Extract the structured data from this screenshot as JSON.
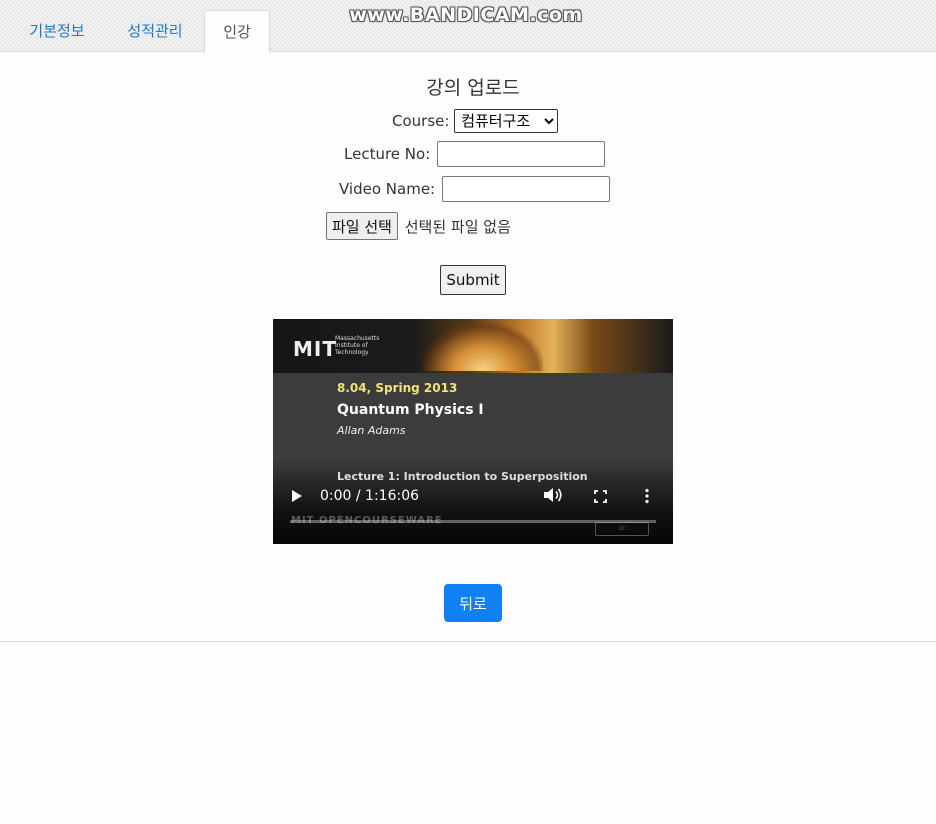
{
  "tabs": [
    {
      "label": "기본정보",
      "active": false
    },
    {
      "label": "성적관리",
      "active": false
    },
    {
      "label": "인강",
      "active": true
    }
  ],
  "watermark": "www.BANDICAM.com",
  "page_title": "강의 업로드",
  "form": {
    "course_label": "Course:",
    "course_selected": "컴퓨터구조",
    "lecture_no_label": "Lecture No:",
    "lecture_no_value": "",
    "video_name_label": "Video Name:",
    "video_name_value": "",
    "file_button_label": "파일 선택",
    "file_status": "선택된 파일 없음",
    "submit_label": "Submit"
  },
  "video": {
    "logo_text": "MIT",
    "institution": "Massachusetts Institute of Technology",
    "course_code": "8.04, Spring 2013",
    "course_title": "Quantum Physics I",
    "instructor": "Allan Adams",
    "lecture_title": "Lecture 1: Introduction to Superposition",
    "time_display": "0:00 / 1:16:06",
    "progress_fraction": 0.0,
    "footer_text": "MIT OPENCOURSEWARE"
  },
  "back_button_label": "뒤로",
  "colors": {
    "tab_link": "#1f77d6",
    "primary_button": "#1180f4",
    "course_code_text": "#f1e27a"
  }
}
